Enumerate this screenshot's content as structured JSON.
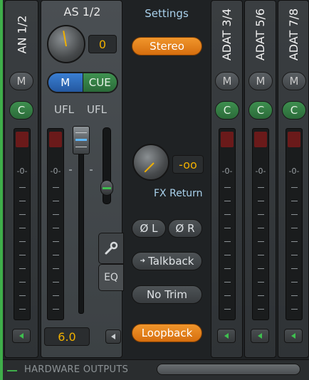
{
  "channels_left": [
    {
      "label": "AN 1/2",
      "m": "M",
      "c": "C",
      "zero": "0"
    }
  ],
  "selected_channel": {
    "label": "AS 1/2",
    "gain_value": "0",
    "m_label": "M",
    "cue_label": "CUE",
    "ufl_left": "UFL",
    "ufl_right": "UFL",
    "zero": "0",
    "fader_value": "6.0",
    "tool_icon": "wrench-icon",
    "eq_label": "EQ"
  },
  "center": {
    "settings_label": "Settings",
    "stereo_label": "Stereo",
    "fx_value": "-oo",
    "fx_label": "FX Return",
    "phase_left": "Ø L",
    "phase_right": "Ø R",
    "talkback_label": "Talkback",
    "notrim_label": "No Trim",
    "loopback_label": "Loopback"
  },
  "channels_right": [
    {
      "label": "ADAT 3/4",
      "m": "M",
      "c": "C",
      "zero": "0"
    },
    {
      "label": "ADAT 5/6",
      "m": "M",
      "c": "C",
      "zero": "0"
    },
    {
      "label": "ADAT 7/8",
      "m": "M",
      "c": "C",
      "zero": "0"
    }
  ],
  "footer": {
    "title": "HARDWARE OUTPUTS"
  },
  "colors": {
    "accent_orange": "#e8821c",
    "blue_m": "#2f6fc0",
    "green": "#3a8a4a",
    "value_yellow": "#f0b000"
  }
}
